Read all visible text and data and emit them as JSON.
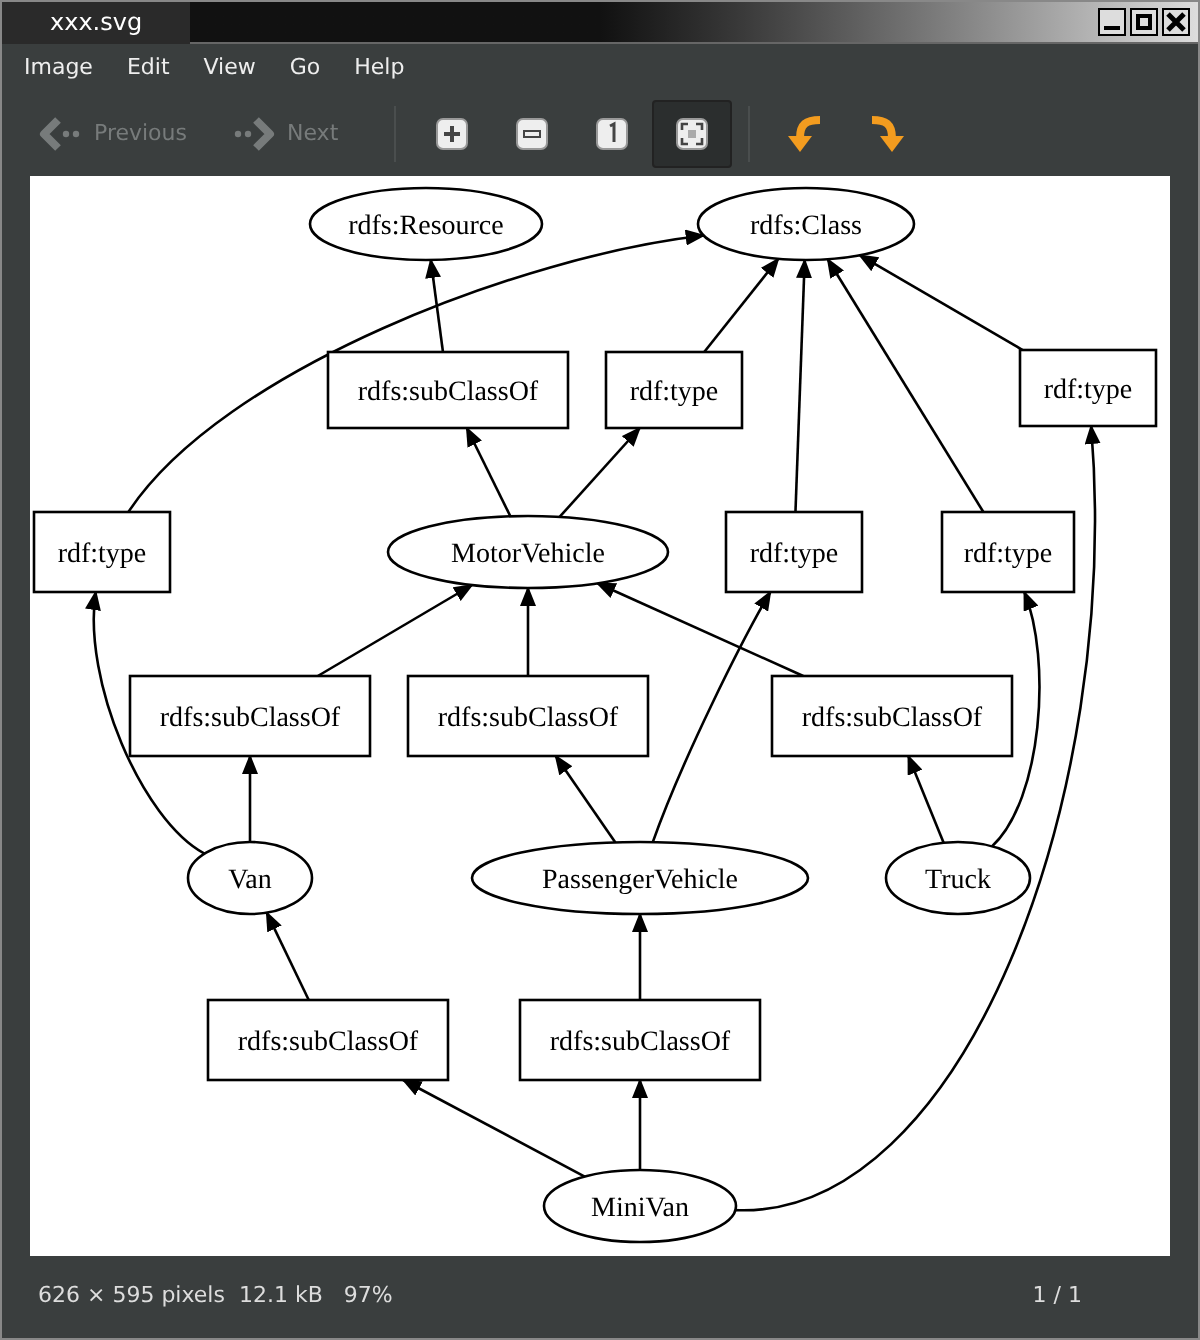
{
  "window": {
    "title": "xxx.svg"
  },
  "menu": [
    "Image",
    "Edit",
    "View",
    "Go",
    "Help"
  ],
  "toolbar": [
    {
      "kind": "previous",
      "label": "Previous",
      "disabled": true
    },
    {
      "kind": "next",
      "label": "Next",
      "disabled": true
    },
    {
      "kind": "zoom-in",
      "selected": false
    },
    {
      "kind": "zoom-out",
      "selected": false
    },
    {
      "kind": "actual-size",
      "selected": false
    },
    {
      "kind": "fit",
      "selected": true
    },
    {
      "kind": "rotate-left"
    },
    {
      "kind": "rotate-right"
    }
  ],
  "graph": {
    "nodes": [
      {
        "label": "rdfs:Resource",
        "kind": "ellipse"
      },
      {
        "label": "rdfs:Class",
        "kind": "ellipse"
      },
      {
        "label": "rdfs:subClassOf",
        "kind": "box"
      },
      {
        "label": "rdf:type",
        "kind": "box"
      },
      {
        "label": "rdf:type",
        "kind": "box"
      },
      {
        "label": "rdf:type",
        "kind": "box"
      },
      {
        "label": "MotorVehicle",
        "kind": "ellipse"
      },
      {
        "label": "rdf:type",
        "kind": "box"
      },
      {
        "label": "rdf:type",
        "kind": "box"
      },
      {
        "label": "rdfs:subClassOf",
        "kind": "box"
      },
      {
        "label": "rdfs:subClassOf",
        "kind": "box"
      },
      {
        "label": "rdfs:subClassOf",
        "kind": "box"
      },
      {
        "label": "Van",
        "kind": "ellipse"
      },
      {
        "label": "PassengerVehicle",
        "kind": "ellipse"
      },
      {
        "label": "Truck",
        "kind": "ellipse"
      },
      {
        "label": "rdfs:subClassOf",
        "kind": "box"
      },
      {
        "label": "rdfs:subClassOf",
        "kind": "box"
      },
      {
        "label": "MiniVan",
        "kind": "ellipse"
      }
    ]
  },
  "status": {
    "info": "626 × 595 pixels  12.1 kB   97%",
    "page": "1 / 1"
  }
}
